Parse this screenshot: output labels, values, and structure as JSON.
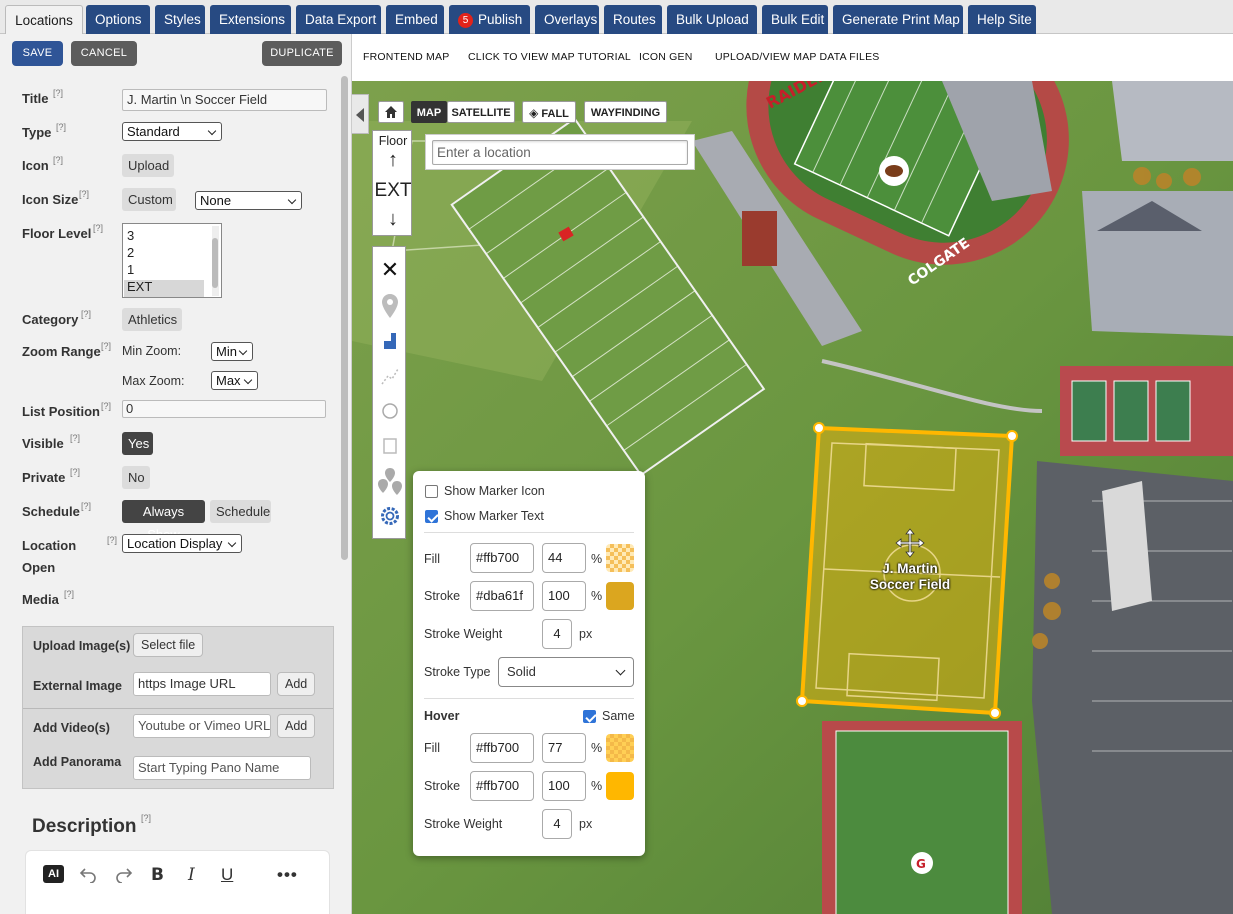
{
  "tabs": [
    {
      "label": "Locations",
      "active": true
    },
    {
      "label": "Options"
    },
    {
      "label": "Styles"
    },
    {
      "label": "Extensions"
    },
    {
      "label": "Data Export"
    },
    {
      "label": "Embed"
    },
    {
      "label": "Publish",
      "badge": "5"
    },
    {
      "label": "Overlays"
    },
    {
      "label": "Routes"
    },
    {
      "label": "Bulk Upload"
    },
    {
      "label": "Bulk Edit"
    },
    {
      "label": "Generate Print Map"
    },
    {
      "label": "Help Site"
    }
  ],
  "actions": {
    "save": "SAVE",
    "cancel": "CANCEL",
    "duplicate": "DUPLICATE"
  },
  "help_marker": "[?]",
  "form": {
    "title_label": "Title",
    "title_value": "J. Martin \\n Soccer Field",
    "type_label": "Type",
    "type_value": "Standard",
    "icon_label": "Icon",
    "icon_button": "Upload",
    "icon_size_label": "Icon Size",
    "icon_size_button": "Custom",
    "icon_size_value": "None",
    "floor_label": "Floor Level",
    "floor_options": [
      "3",
      "2",
      "1",
      "EXT"
    ],
    "floor_selected": "EXT",
    "category_label": "Category",
    "category_value": "Athletics",
    "zoom_label": "Zoom Range",
    "min_zoom_label": "Min Zoom:",
    "min_zoom_value": "Min",
    "max_zoom_label": "Max Zoom:",
    "max_zoom_value": "Max",
    "list_position_label": "List Position",
    "list_position_value": "0",
    "visible_label": "Visible",
    "visible_value": "Yes",
    "private_label": "Private",
    "private_value": "No",
    "schedule_label": "Schedule",
    "schedule_always": "Always Show",
    "schedule_button": "Schedule",
    "location_open_label_1": "Location",
    "location_open_label_2": "Open",
    "location_open_value": "Location Display",
    "media_label": "Media"
  },
  "media": {
    "upload_images_label": "Upload Image(s)",
    "select_file": "Select file",
    "external_image_label": "External Image",
    "external_image_value": "https Image URL",
    "add": "Add",
    "add_videos_label": "Add Video(s)",
    "video_placeholder": "Youtube or Vimeo URL",
    "add_panorama_label": "Add Panorama",
    "panorama_placeholder": "Start Typing Pano Name"
  },
  "description": {
    "heading": "Description",
    "ai_label": "AI"
  },
  "subnav": [
    "FRONTEND MAP",
    "CLICK TO VIEW MAP TUTORIAL",
    "ICON GEN",
    "UPLOAD/VIEW MAP DATA FILES"
  ],
  "map": {
    "view_buttons": [
      "MAP",
      "SATELLITE"
    ],
    "layer_button": "FALL",
    "wayfinding_button": "WAYFINDING",
    "floor_heading": "Floor",
    "floor_current": "EXT",
    "search_placeholder": "Enter a location",
    "field_label_line1": "J. Martin",
    "field_label_line2": "Soccer Field",
    "field_text_top": "RAIDERS",
    "field_text_side": "COLGATE"
  },
  "style_popup": {
    "show_marker_icon": "Show Marker Icon",
    "show_marker_icon_checked": false,
    "show_marker_text": "Show Marker Text",
    "show_marker_text_checked": true,
    "fill_label": "Fill",
    "fill_color": "#ffb700",
    "fill_opacity": "44",
    "stroke_label": "Stroke",
    "stroke_color": "#dba61f",
    "stroke_opacity": "100",
    "stroke_weight_label": "Stroke Weight",
    "stroke_weight": "4",
    "px": "px",
    "pct": "%",
    "stroke_type_label": "Stroke Type",
    "stroke_type": "Solid",
    "hover_label": "Hover",
    "same_label": "Same",
    "same_checked": true,
    "hover_fill_color": "#ffb700",
    "hover_fill_opacity": "77",
    "hover_stroke_color": "#ffb700",
    "hover_stroke_opacity": "100",
    "hover_stroke_weight": "4"
  }
}
